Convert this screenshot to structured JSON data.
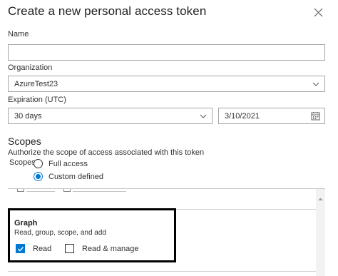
{
  "dialog": {
    "title": "Create a new personal access token"
  },
  "name": {
    "label": "Name",
    "value": "",
    "placeholder": ""
  },
  "organization": {
    "label": "Organization",
    "value": "AzureTest23"
  },
  "expiration": {
    "label": "Expiration (UTC)",
    "value": "30 days",
    "date": "3/10/2021"
  },
  "scopes": {
    "title": "Scopes",
    "description": "Authorize the scope of access associated with this token",
    "label": "Scopes",
    "options": [
      {
        "label": "Full access",
        "selected": false
      },
      {
        "label": "Custom defined",
        "selected": true
      }
    ]
  },
  "graph": {
    "title": "Graph",
    "description": "Read, group, scope, and add",
    "read_label": "Read",
    "read_checked": true,
    "manage_label": "Read & manage",
    "manage_checked": false
  },
  "colors": {
    "accent": "#0078d4",
    "text": "#323130",
    "border": "#a8a6a3"
  },
  "icons": [
    "close-icon",
    "chevron-down-icon",
    "calendar-icon",
    "checkmark-icon",
    "scroll-up-arrow-icon"
  ]
}
